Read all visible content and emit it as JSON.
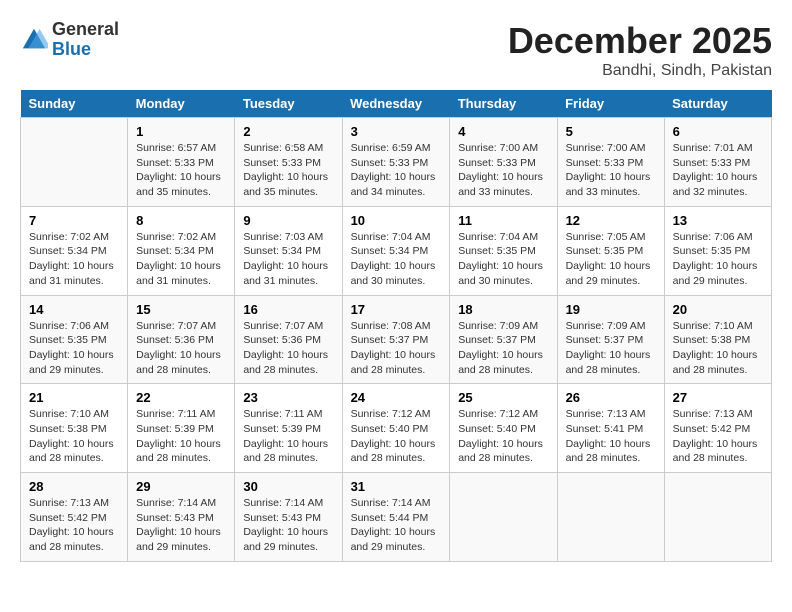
{
  "logo": {
    "general": "General",
    "blue": "Blue"
  },
  "title": "December 2025",
  "subtitle": "Bandhi, Sindh, Pakistan",
  "headers": [
    "Sunday",
    "Monday",
    "Tuesday",
    "Wednesday",
    "Thursday",
    "Friday",
    "Saturday"
  ],
  "weeks": [
    [
      {
        "day": "",
        "info": ""
      },
      {
        "day": "1",
        "info": "Sunrise: 6:57 AM\nSunset: 5:33 PM\nDaylight: 10 hours and 35 minutes."
      },
      {
        "day": "2",
        "info": "Sunrise: 6:58 AM\nSunset: 5:33 PM\nDaylight: 10 hours and 35 minutes."
      },
      {
        "day": "3",
        "info": "Sunrise: 6:59 AM\nSunset: 5:33 PM\nDaylight: 10 hours and 34 minutes."
      },
      {
        "day": "4",
        "info": "Sunrise: 7:00 AM\nSunset: 5:33 PM\nDaylight: 10 hours and 33 minutes."
      },
      {
        "day": "5",
        "info": "Sunrise: 7:00 AM\nSunset: 5:33 PM\nDaylight: 10 hours and 33 minutes."
      },
      {
        "day": "6",
        "info": "Sunrise: 7:01 AM\nSunset: 5:33 PM\nDaylight: 10 hours and 32 minutes."
      }
    ],
    [
      {
        "day": "7",
        "info": "Sunrise: 7:02 AM\nSunset: 5:34 PM\nDaylight: 10 hours and 31 minutes."
      },
      {
        "day": "8",
        "info": "Sunrise: 7:02 AM\nSunset: 5:34 PM\nDaylight: 10 hours and 31 minutes."
      },
      {
        "day": "9",
        "info": "Sunrise: 7:03 AM\nSunset: 5:34 PM\nDaylight: 10 hours and 31 minutes."
      },
      {
        "day": "10",
        "info": "Sunrise: 7:04 AM\nSunset: 5:34 PM\nDaylight: 10 hours and 30 minutes."
      },
      {
        "day": "11",
        "info": "Sunrise: 7:04 AM\nSunset: 5:35 PM\nDaylight: 10 hours and 30 minutes."
      },
      {
        "day": "12",
        "info": "Sunrise: 7:05 AM\nSunset: 5:35 PM\nDaylight: 10 hours and 29 minutes."
      },
      {
        "day": "13",
        "info": "Sunrise: 7:06 AM\nSunset: 5:35 PM\nDaylight: 10 hours and 29 minutes."
      }
    ],
    [
      {
        "day": "14",
        "info": "Sunrise: 7:06 AM\nSunset: 5:35 PM\nDaylight: 10 hours and 29 minutes."
      },
      {
        "day": "15",
        "info": "Sunrise: 7:07 AM\nSunset: 5:36 PM\nDaylight: 10 hours and 28 minutes."
      },
      {
        "day": "16",
        "info": "Sunrise: 7:07 AM\nSunset: 5:36 PM\nDaylight: 10 hours and 28 minutes."
      },
      {
        "day": "17",
        "info": "Sunrise: 7:08 AM\nSunset: 5:37 PM\nDaylight: 10 hours and 28 minutes."
      },
      {
        "day": "18",
        "info": "Sunrise: 7:09 AM\nSunset: 5:37 PM\nDaylight: 10 hours and 28 minutes."
      },
      {
        "day": "19",
        "info": "Sunrise: 7:09 AM\nSunset: 5:37 PM\nDaylight: 10 hours and 28 minutes."
      },
      {
        "day": "20",
        "info": "Sunrise: 7:10 AM\nSunset: 5:38 PM\nDaylight: 10 hours and 28 minutes."
      }
    ],
    [
      {
        "day": "21",
        "info": "Sunrise: 7:10 AM\nSunset: 5:38 PM\nDaylight: 10 hours and 28 minutes."
      },
      {
        "day": "22",
        "info": "Sunrise: 7:11 AM\nSunset: 5:39 PM\nDaylight: 10 hours and 28 minutes."
      },
      {
        "day": "23",
        "info": "Sunrise: 7:11 AM\nSunset: 5:39 PM\nDaylight: 10 hours and 28 minutes."
      },
      {
        "day": "24",
        "info": "Sunrise: 7:12 AM\nSunset: 5:40 PM\nDaylight: 10 hours and 28 minutes."
      },
      {
        "day": "25",
        "info": "Sunrise: 7:12 AM\nSunset: 5:40 PM\nDaylight: 10 hours and 28 minutes."
      },
      {
        "day": "26",
        "info": "Sunrise: 7:13 AM\nSunset: 5:41 PM\nDaylight: 10 hours and 28 minutes."
      },
      {
        "day": "27",
        "info": "Sunrise: 7:13 AM\nSunset: 5:42 PM\nDaylight: 10 hours and 28 minutes."
      }
    ],
    [
      {
        "day": "28",
        "info": "Sunrise: 7:13 AM\nSunset: 5:42 PM\nDaylight: 10 hours and 28 minutes."
      },
      {
        "day": "29",
        "info": "Sunrise: 7:14 AM\nSunset: 5:43 PM\nDaylight: 10 hours and 29 minutes."
      },
      {
        "day": "30",
        "info": "Sunrise: 7:14 AM\nSunset: 5:43 PM\nDaylight: 10 hours and 29 minutes."
      },
      {
        "day": "31",
        "info": "Sunrise: 7:14 AM\nSunset: 5:44 PM\nDaylight: 10 hours and 29 minutes."
      },
      {
        "day": "",
        "info": ""
      },
      {
        "day": "",
        "info": ""
      },
      {
        "day": "",
        "info": ""
      }
    ]
  ]
}
